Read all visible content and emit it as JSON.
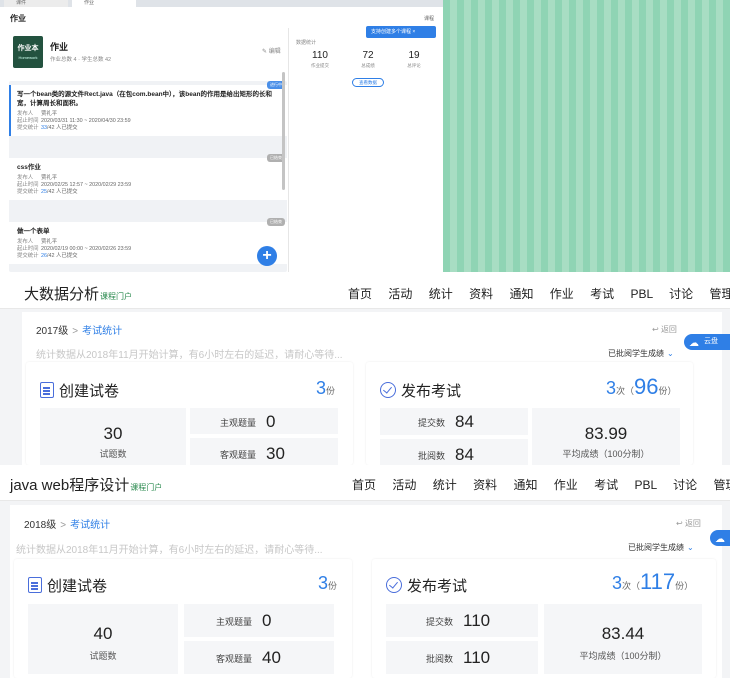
{
  "homework_app": {
    "tabs": [
      {
        "label": "课件"
      },
      {
        "label": "作业"
      }
    ],
    "page_title": "作业",
    "top_right": "课程",
    "book": {
      "cover_text": "作业本",
      "cover_sub": "Homework",
      "title": "作业",
      "meta": "作业总数 4 · 学生总数 42",
      "edit_label": "编辑"
    },
    "stats": {
      "label": "数据统计",
      "items": [
        {
          "value": "110",
          "label": "作业提交"
        },
        {
          "value": "72",
          "label": "总成绩"
        },
        {
          "value": "19",
          "label": "总评论"
        }
      ],
      "view_button": "查看数据"
    },
    "toast": "支持创建多个课程 ×",
    "list": [
      {
        "title": "写一个bean类的源文件Rect.java（在包com.bean中），该bean的作用是给出矩形的长和宽，计算周长和面积。",
        "publisher_key": "发布人",
        "publisher": "贾礼平",
        "time_key": "起止时间",
        "time": "2020/03/31 11:30 ~ 2020/04/30 23:59",
        "submit_key": "提交统计",
        "submitted": "33",
        "submit_tail": "/42 人已提交",
        "badge": "进行中"
      },
      {
        "title": "css作业",
        "publisher_key": "发布人",
        "publisher": "贾礼平",
        "time_key": "起止时间",
        "time": "2020/02/25 12:57 ~ 2020/02/29 23:59",
        "submit_key": "提交统计",
        "submitted": "25",
        "submit_tail": "/42 人已提交",
        "badge": "已结束"
      },
      {
        "title": "做一个表单",
        "publisher_key": "发布人",
        "publisher": "贾礼平",
        "time_key": "起止时间",
        "time": "2020/02/19 00:00 ~ 2020/02/26 23:59",
        "submit_key": "提交统计",
        "submitted": "26",
        "submit_tail": "/42 人已提交",
        "badge": "已结束"
      }
    ],
    "fab": "+"
  },
  "portal_b": {
    "title": "大数据分析",
    "portal": "课程门户",
    "nav": [
      "首页",
      "活动",
      "统计",
      "资料",
      "通知",
      "作业",
      "考试",
      "PBL",
      "讨论",
      "管理"
    ],
    "crumb_grade": "2017级",
    "crumb_sep": ">",
    "crumb_link": "考试统计",
    "back": "返回",
    "notice": "统计数据从2018年11月开始计算，有6小时左右的延迟，请耐心等待...",
    "filter": "已批阅学生成绩",
    "filter_chev": "⌄",
    "cloud": "云盘",
    "create": {
      "title": "创建试卷",
      "count": "3",
      "unit": "份",
      "total": "30",
      "total_label": "试题数",
      "subjective_label": "主观题量",
      "subjective": "0",
      "objective_label": "客观题量",
      "objective": "30"
    },
    "publish": {
      "title": "发布考试",
      "times": "3",
      "times_unit": "次（",
      "copies": "96",
      "copies_unit": "份）",
      "submit_label": "提交数",
      "submit": "84",
      "review_label": "批阅数",
      "review": "84",
      "avg": "83.99",
      "avg_label": "平均成绩（100分制）"
    }
  },
  "portal_c": {
    "title": "java web程序设计",
    "portal": "课程门户",
    "nav": [
      "首页",
      "活动",
      "统计",
      "资料",
      "通知",
      "作业",
      "考试",
      "PBL",
      "讨论",
      "管理"
    ],
    "crumb_grade": "2018级",
    "crumb_sep": ">",
    "crumb_link": "考试统计",
    "back": "返回",
    "notice": "统计数据从2018年11月开始计算，有6小时左右的延迟，请耐心等待...",
    "filter": "已批阅学生成绩",
    "filter_chev": "⌄",
    "cloud": "云盘",
    "create": {
      "title": "创建试卷",
      "count": "3",
      "unit": "份",
      "total": "40",
      "total_label": "试题数",
      "subjective_label": "主观题量",
      "subjective": "0",
      "objective_label": "客观题量",
      "objective": "40"
    },
    "publish": {
      "title": "发布考试",
      "times": "3",
      "times_unit": "次（",
      "copies": "117",
      "copies_unit": "份）",
      "submit_label": "提交数",
      "submit": "110",
      "review_label": "批阅数",
      "review": "110",
      "avg": "83.44",
      "avg_label": "平均成绩（100分制）"
    }
  },
  "colors": {
    "accent": "#2f7fe6",
    "portal_green": "#2a8a4e",
    "stripe_green": "#8fd4b4"
  }
}
